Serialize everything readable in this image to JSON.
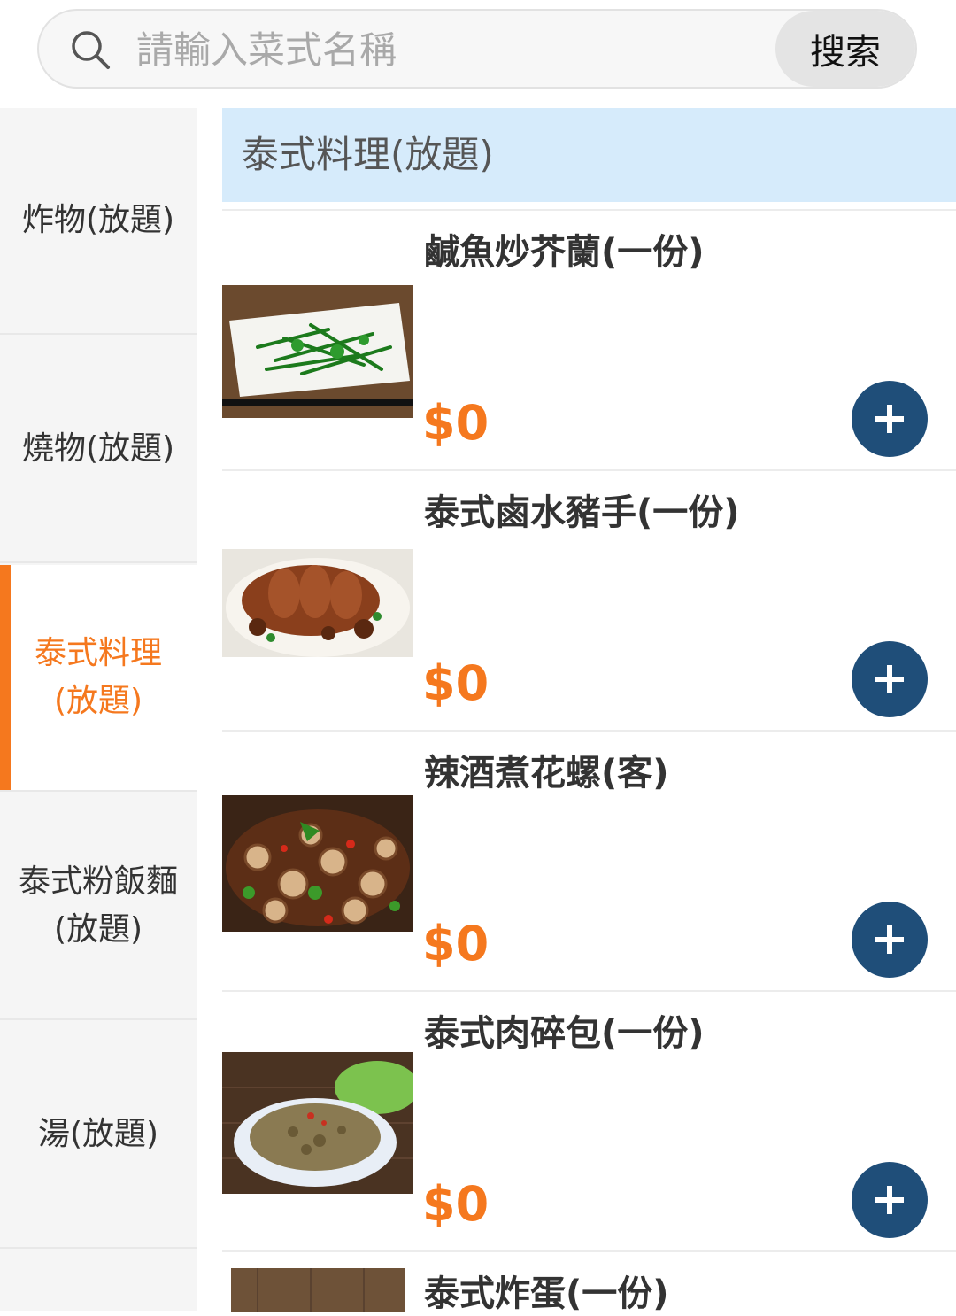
{
  "search": {
    "placeholder": "請輸入菜式名稱",
    "button_label": "搜索",
    "icon": "search-icon"
  },
  "sidebar": {
    "items": [
      {
        "label": "炸物(放題)",
        "active": false
      },
      {
        "label": "燒物(放題)",
        "active": false
      },
      {
        "label": "泰式料理\n(放題)",
        "active": true
      },
      {
        "label": "泰式粉飯麵\n(放題)",
        "active": false
      },
      {
        "label": "湯(放題)",
        "active": false
      }
    ]
  },
  "section": {
    "title": "泰式料理(放題)"
  },
  "menu_items": [
    {
      "name": "鹹魚炒芥蘭(一份)",
      "price": "$0",
      "image": "stir-fried-greens-photo"
    },
    {
      "name": "泰式鹵水豬手(一份)",
      "price": "$0",
      "image": "braised-pork-knuckle-photo"
    },
    {
      "name": "辣酒煮花螺(客)",
      "price": "$0",
      "image": "spicy-snails-photo"
    },
    {
      "name": "泰式肉碎包(一份)",
      "price": "$0",
      "image": "minced-meat-lettuce-photo"
    },
    {
      "name": "泰式炸蛋(一份)",
      "price": "",
      "image": "fried-egg-photo"
    }
  ],
  "colors": {
    "accent": "#f5781e",
    "add_button": "#1f4e79",
    "section_header_bg": "#d6ebfb"
  }
}
